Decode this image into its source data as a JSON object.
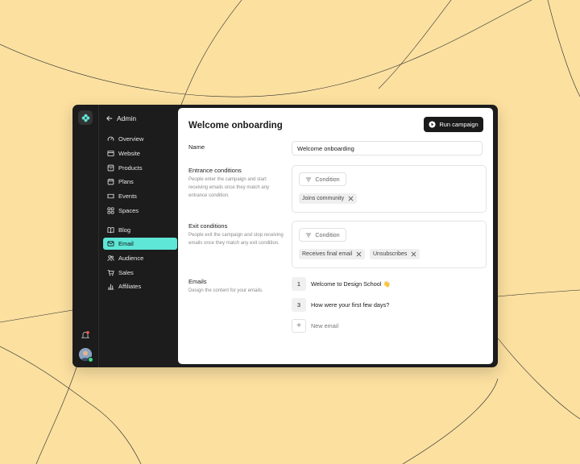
{
  "window": {
    "title": "Welcome onboarding"
  },
  "sidebar": {
    "back_label": "Admin",
    "groups": [
      [
        {
          "label": "Overview",
          "icon": "gauge-icon"
        },
        {
          "label": "Website",
          "icon": "browser-icon"
        },
        {
          "label": "Products",
          "icon": "box-icon"
        },
        {
          "label": "Plans",
          "icon": "calendar-icon"
        },
        {
          "label": "Events",
          "icon": "ticket-icon"
        },
        {
          "label": "Spaces",
          "icon": "grid-icon"
        }
      ],
      [
        {
          "label": "Blog",
          "icon": "book-icon"
        },
        {
          "label": "Email",
          "icon": "mail-icon",
          "active": true
        },
        {
          "label": "Audience",
          "icon": "users-icon"
        },
        {
          "label": "Sales",
          "icon": "cart-icon"
        },
        {
          "label": "Affiliates",
          "icon": "chart-icon"
        }
      ]
    ]
  },
  "header": {
    "run_button_label": "Run campaign"
  },
  "form": {
    "name": {
      "label": "Name",
      "value": "Welcome onboarding"
    },
    "entrance": {
      "label": "Entrance conditions",
      "description": "People enter the campaign and start receiving emails once they match any entrance condition.",
      "condition_button": "Condition",
      "chips": [
        "Joins community"
      ]
    },
    "exit": {
      "label": "Exit conditions",
      "description": "People exit the campaign and stop receiving emails once they match any exit condition.",
      "condition_button": "Condition",
      "chips": [
        "Receives final email",
        "Unsubscribes"
      ]
    },
    "emails": {
      "label": "Emails",
      "description": "Design the content for your emails.",
      "items": [
        {
          "number": "1",
          "subject": "Welcome to Design School 👋"
        },
        {
          "number": "3",
          "subject": "How were your first few days?"
        }
      ],
      "new_label": "New email"
    }
  },
  "colors": {
    "accent": "#5ee6d6",
    "background": "#fbe0a0",
    "sidebar": "#1c1c1c"
  }
}
